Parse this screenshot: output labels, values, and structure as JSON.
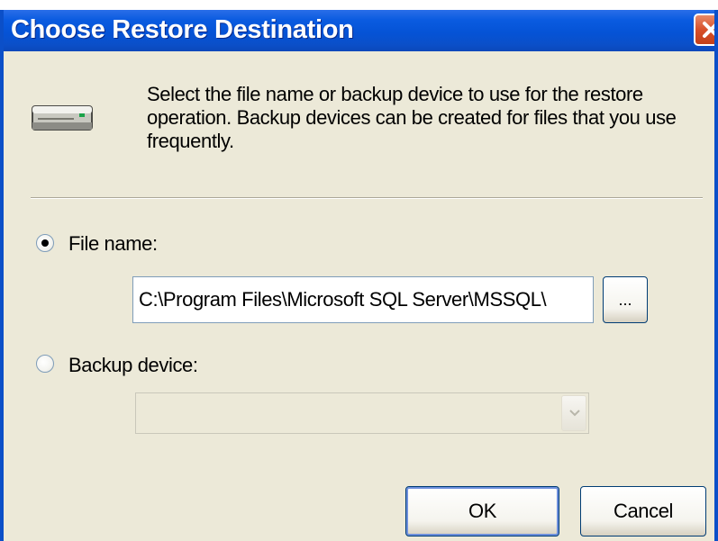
{
  "window": {
    "title": "Choose Restore Destination",
    "close_icon": "close-icon",
    "titlebar_color": "#0553d6",
    "face_color": "#ece9d8"
  },
  "header": {
    "icon": "backup-device-icon",
    "description": "Select the file name or backup device to use for the restore operation.  Backup devices can be created for files that you use frequently."
  },
  "options": {
    "file_name": {
      "label": "File name:",
      "selected": true,
      "value": "C:\\Program Files\\Microsoft SQL Server\\MSSQL\\",
      "browse_label": "..."
    },
    "backup_device": {
      "label": "Backup device:",
      "selected": false,
      "value": "",
      "enabled": false
    }
  },
  "buttons": {
    "ok_label": "OK",
    "cancel_label": "Cancel"
  }
}
